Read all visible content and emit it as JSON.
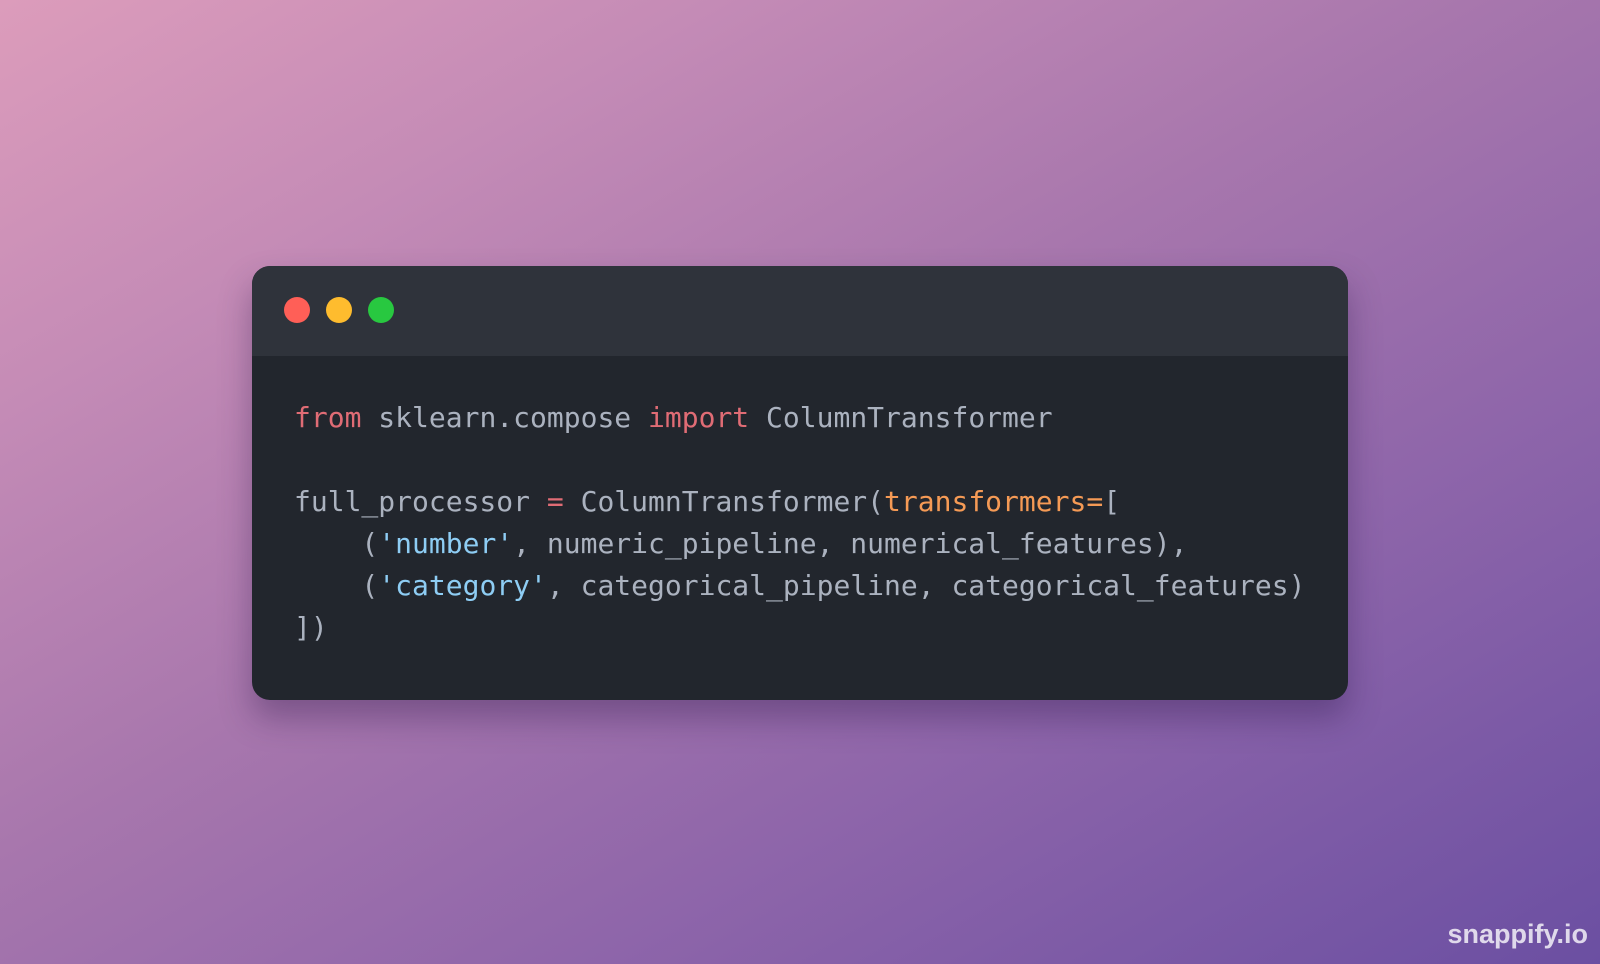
{
  "window": {
    "controls": [
      {
        "name": "close",
        "color": "#ff5f57"
      },
      {
        "name": "minimize",
        "color": "#febc2e"
      },
      {
        "name": "maximize",
        "color": "#28c840"
      }
    ]
  },
  "code": {
    "language": "python",
    "lines": [
      [
        {
          "text": "from",
          "type": "keyword"
        },
        {
          "text": " sklearn.compose ",
          "type": "plain"
        },
        {
          "text": "import",
          "type": "keyword"
        },
        {
          "text": " ColumnTransformer",
          "type": "plain"
        }
      ],
      [],
      [
        {
          "text": "full_processor ",
          "type": "plain"
        },
        {
          "text": "=",
          "type": "keyword"
        },
        {
          "text": " ColumnTransformer(",
          "type": "plain"
        },
        {
          "text": "transformers=",
          "type": "param"
        },
        {
          "text": "[",
          "type": "plain"
        }
      ],
      [
        {
          "text": "    (",
          "type": "plain"
        },
        {
          "text": "'number'",
          "type": "string"
        },
        {
          "text": ", numeric_pipeline, numerical_features),",
          "type": "plain"
        }
      ],
      [
        {
          "text": "    (",
          "type": "plain"
        },
        {
          "text": "'category'",
          "type": "string"
        },
        {
          "text": ", categorical_pipeline, categorical_features)",
          "type": "plain"
        }
      ],
      [
        {
          "text": "])",
          "type": "plain"
        }
      ]
    ]
  },
  "watermark": "snappify.io",
  "colors": {
    "keyword": "#e06c75",
    "param": "#f59a55",
    "string": "#8ecdf4",
    "plain": "#abb2bf",
    "window_bg": "#22262d",
    "titlebar_bg": "#2f333b"
  }
}
